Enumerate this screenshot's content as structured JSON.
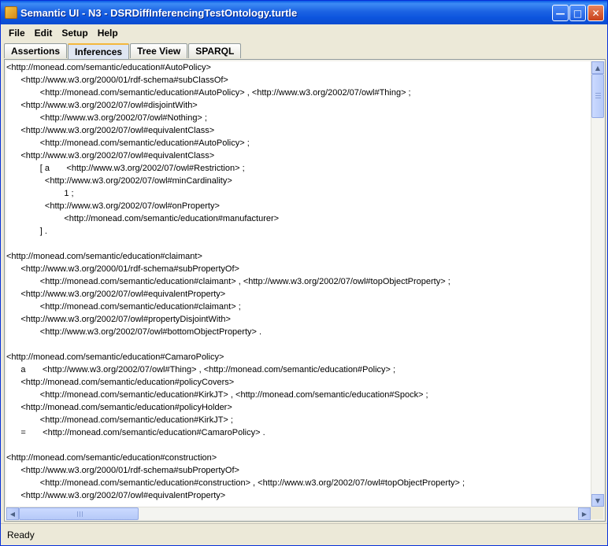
{
  "window": {
    "title": "Semantic UI - N3 - DSRDiffInferencingTestOntology.turtle"
  },
  "menu": [
    "File",
    "Edit",
    "Setup",
    "Help"
  ],
  "tabs": [
    "Assertions",
    "Inferences",
    "Tree View",
    "SPARQL"
  ],
  "active_tab": "Inferences",
  "lines": [
    "<http://monead.com/semantic/education#AutoPolicy>",
    "      <http://www.w3.org/2000/01/rdf-schema#subClassOf>",
    "              <http://monead.com/semantic/education#AutoPolicy> , <http://www.w3.org/2002/07/owl#Thing> ;",
    "      <http://www.w3.org/2002/07/owl#disjointWith>",
    "              <http://www.w3.org/2002/07/owl#Nothing> ;",
    "      <http://www.w3.org/2002/07/owl#equivalentClass>",
    "              <http://monead.com/semantic/education#AutoPolicy> ;",
    "      <http://www.w3.org/2002/07/owl#equivalentClass>",
    "              [ a       <http://www.w3.org/2002/07/owl#Restriction> ;",
    "                <http://www.w3.org/2002/07/owl#minCardinality>",
    "                        1 ;",
    "                <http://www.w3.org/2002/07/owl#onProperty>",
    "                        <http://monead.com/semantic/education#manufacturer>",
    "              ] .",
    "",
    "<http://monead.com/semantic/education#claimant>",
    "      <http://www.w3.org/2000/01/rdf-schema#subPropertyOf>",
    "              <http://monead.com/semantic/education#claimant> , <http://www.w3.org/2002/07/owl#topObjectProperty> ;",
    "      <http://www.w3.org/2002/07/owl#equivalentProperty>",
    "              <http://monead.com/semantic/education#claimant> ;",
    "      <http://www.w3.org/2002/07/owl#propertyDisjointWith>",
    "              <http://www.w3.org/2002/07/owl#bottomObjectProperty> .",
    "",
    "<http://monead.com/semantic/education#CamaroPolicy>",
    "      a       <http://www.w3.org/2002/07/owl#Thing> , <http://monead.com/semantic/education#Policy> ;",
    "      <http://monead.com/semantic/education#policyCovers>",
    "              <http://monead.com/semantic/education#KirkJT> , <http://monead.com/semantic/education#Spock> ;",
    "      <http://monead.com/semantic/education#policyHolder>",
    "              <http://monead.com/semantic/education#KirkJT> ;",
    "      =       <http://monead.com/semantic/education#CamaroPolicy> .",
    "",
    "<http://monead.com/semantic/education#construction>",
    "      <http://www.w3.org/2000/01/rdf-schema#subPropertyOf>",
    "              <http://monead.com/semantic/education#construction> , <http://www.w3.org/2002/07/owl#topObjectProperty> ;",
    "      <http://www.w3.org/2002/07/owl#equivalentProperty>"
  ],
  "status": "Ready"
}
